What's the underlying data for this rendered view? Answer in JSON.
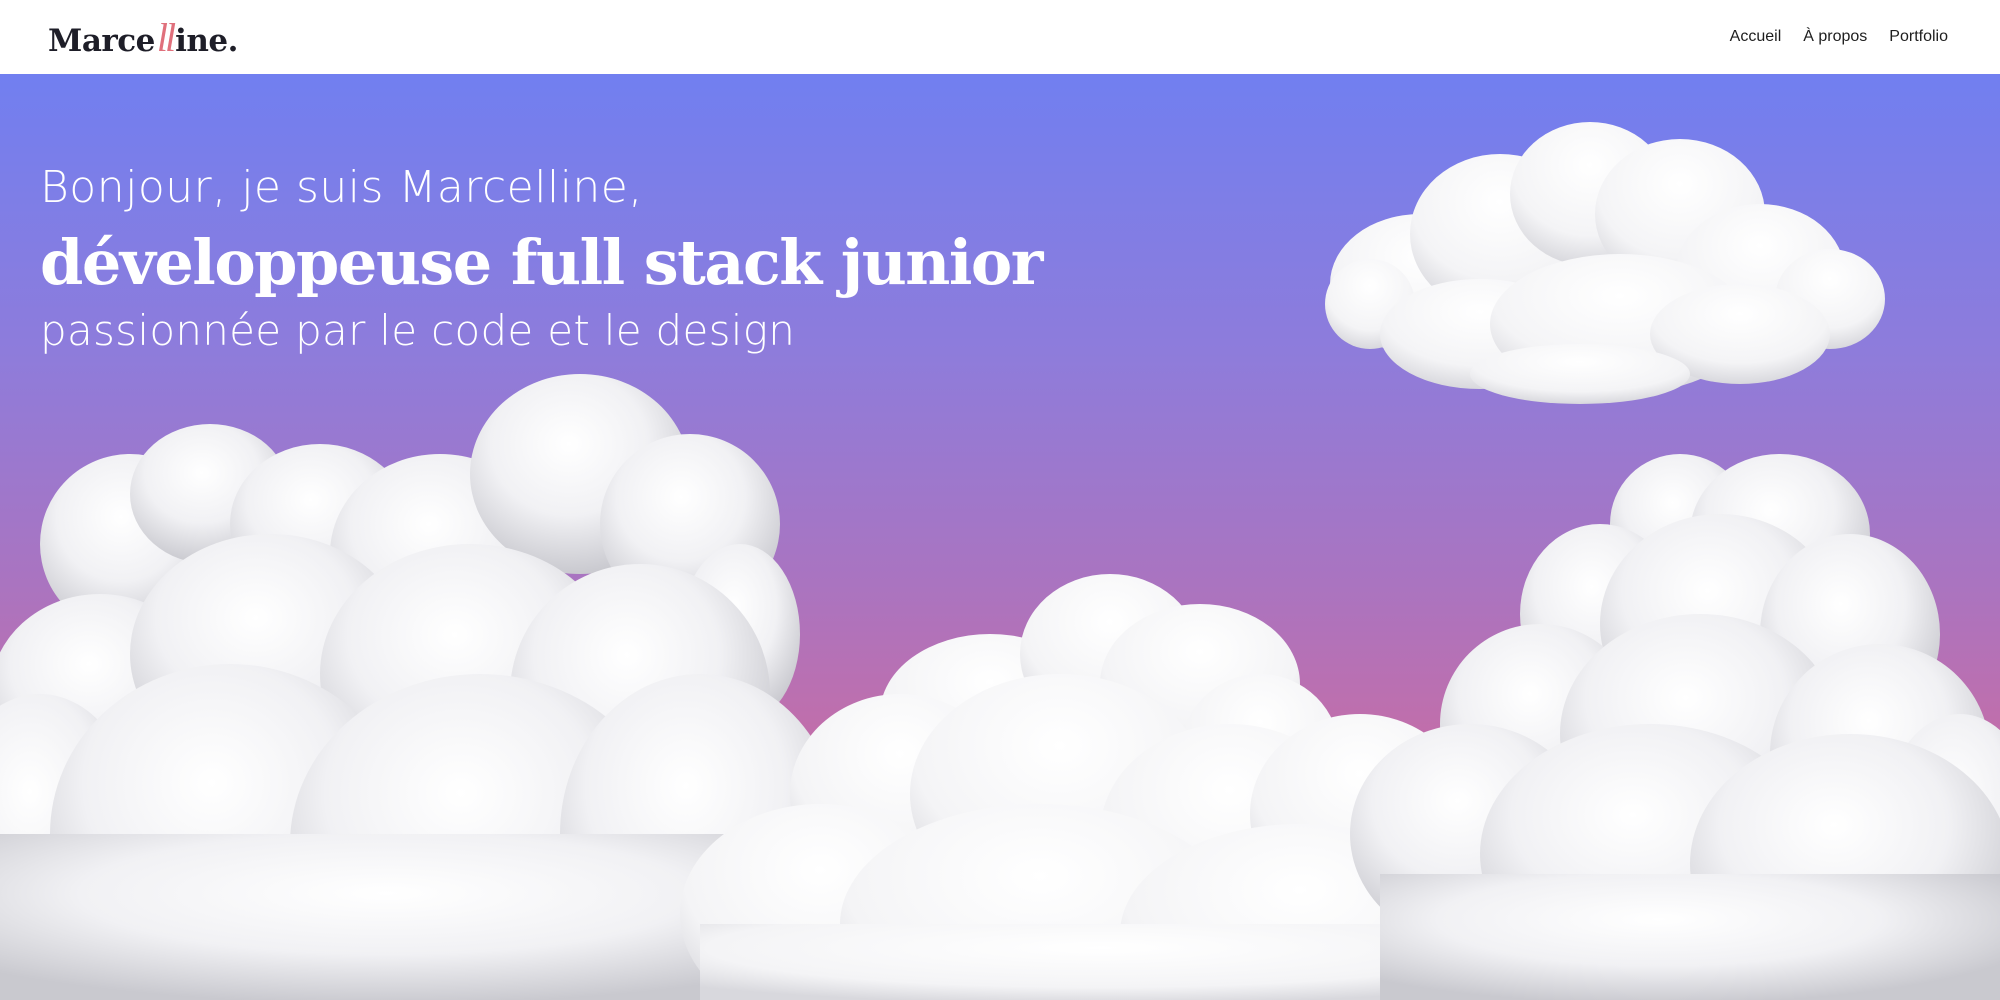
{
  "header": {
    "logo": {
      "before": "Marce",
      "accent": "ll",
      "after": "ine."
    },
    "nav": [
      "Accueil",
      "À propos",
      "Portfolio"
    ]
  },
  "hero": {
    "greeting": "Bonjour, je suis Marcelline,",
    "role": "développeuse full stack junior",
    "tagline": "passionnée par le code et le design"
  },
  "colors": {
    "gradient_top": "#717ff0",
    "gradient_bottom": "#c86ea2",
    "logo_accent": "#e0707c",
    "text_dark": "#1e1e28"
  },
  "icons": [
    "cloud-illustration"
  ]
}
